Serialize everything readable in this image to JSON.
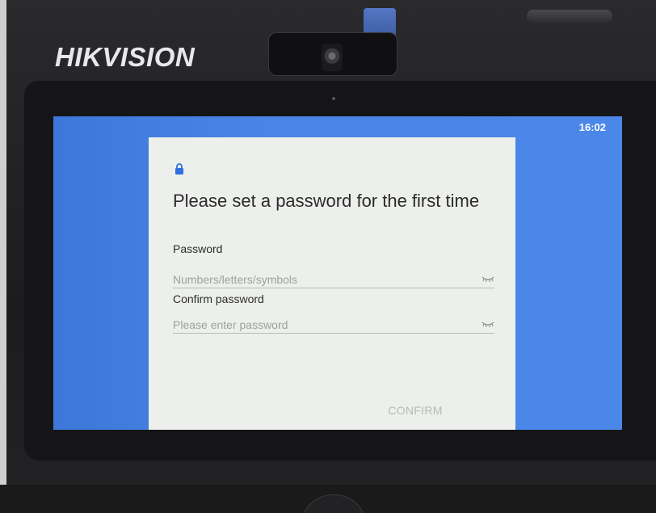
{
  "device": {
    "brand": "HIKVISION"
  },
  "status_bar": {
    "time": "16:02"
  },
  "dialog": {
    "icon": "lock-icon",
    "title": "Please set a password for the first time",
    "password": {
      "label": "Password",
      "value": "",
      "placeholder": "Numbers/letters/symbols",
      "toggle_icon": "eye-closed-icon"
    },
    "confirm_password": {
      "label": "Confirm password",
      "value": "",
      "placeholder": "Please enter password",
      "toggle_icon": "eye-closed-icon"
    },
    "confirm_label": "CONFIRM"
  },
  "colors": {
    "screen_background": "#4b87e8",
    "dialog_background": "#ecefeb",
    "lock_icon": "#2f6fe0",
    "confirm_disabled": "#b7bab6"
  }
}
